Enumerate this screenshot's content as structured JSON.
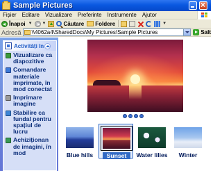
{
  "window": {
    "title": "Sample Pictures"
  },
  "menu": {
    "items": [
      "Fișier",
      "Editare",
      "Vizualizare",
      "Preferinte",
      "Instrumente",
      "Ajutor"
    ]
  },
  "toolbar": {
    "back_label": "Înapoi",
    "search_label": "Căutare",
    "folders_label": "Foldere"
  },
  "address": {
    "label": "Adresă",
    "path": "\\\\4062a4\\SharedDocs\\My Pictures\\Sample Pictures",
    "go_label": "Salt"
  },
  "taskpane": {
    "title": "Activități în",
    "items": [
      {
        "label": "Vizualizare ca diapozitive",
        "icon": "slideshow-icon"
      },
      {
        "label": "Comandare materiale imprimate, în mod conectat",
        "icon": "order-prints-icon"
      },
      {
        "label": "Imprimare imagine",
        "icon": "print-icon"
      },
      {
        "label": "Stabilire ca fundal pentru spațiul de lucru",
        "icon": "desktop-background-icon"
      },
      {
        "label": "Achiziționan de imagini, în mod",
        "icon": "buy-icon"
      }
    ]
  },
  "thumbnails": [
    {
      "label": "Blue hills",
      "selected": false
    },
    {
      "label": "Sunset",
      "selected": true
    },
    {
      "label": "Water lilies",
      "selected": false
    },
    {
      "label": "Winter",
      "selected": false
    }
  ],
  "colors": {
    "titlebar": "#0a58e0",
    "taskpane": "#6f8ddd",
    "selection": "#316ac5"
  }
}
